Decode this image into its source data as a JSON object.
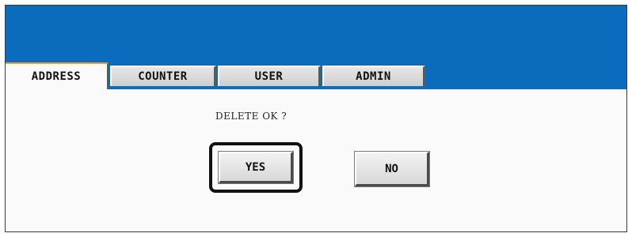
{
  "tabs": [
    {
      "label": "ADDRESS",
      "active": true
    },
    {
      "label": "COUNTER",
      "active": false
    },
    {
      "label": "USER",
      "active": false
    },
    {
      "label": "ADMIN",
      "active": false
    }
  ],
  "dialog": {
    "prompt": "DELETE OK ?",
    "yes_label": "YES",
    "no_label": "NO"
  },
  "colors": {
    "header": "#0b6bbd",
    "active_tab_accent": "#f0a030",
    "background": "#fafafa"
  }
}
